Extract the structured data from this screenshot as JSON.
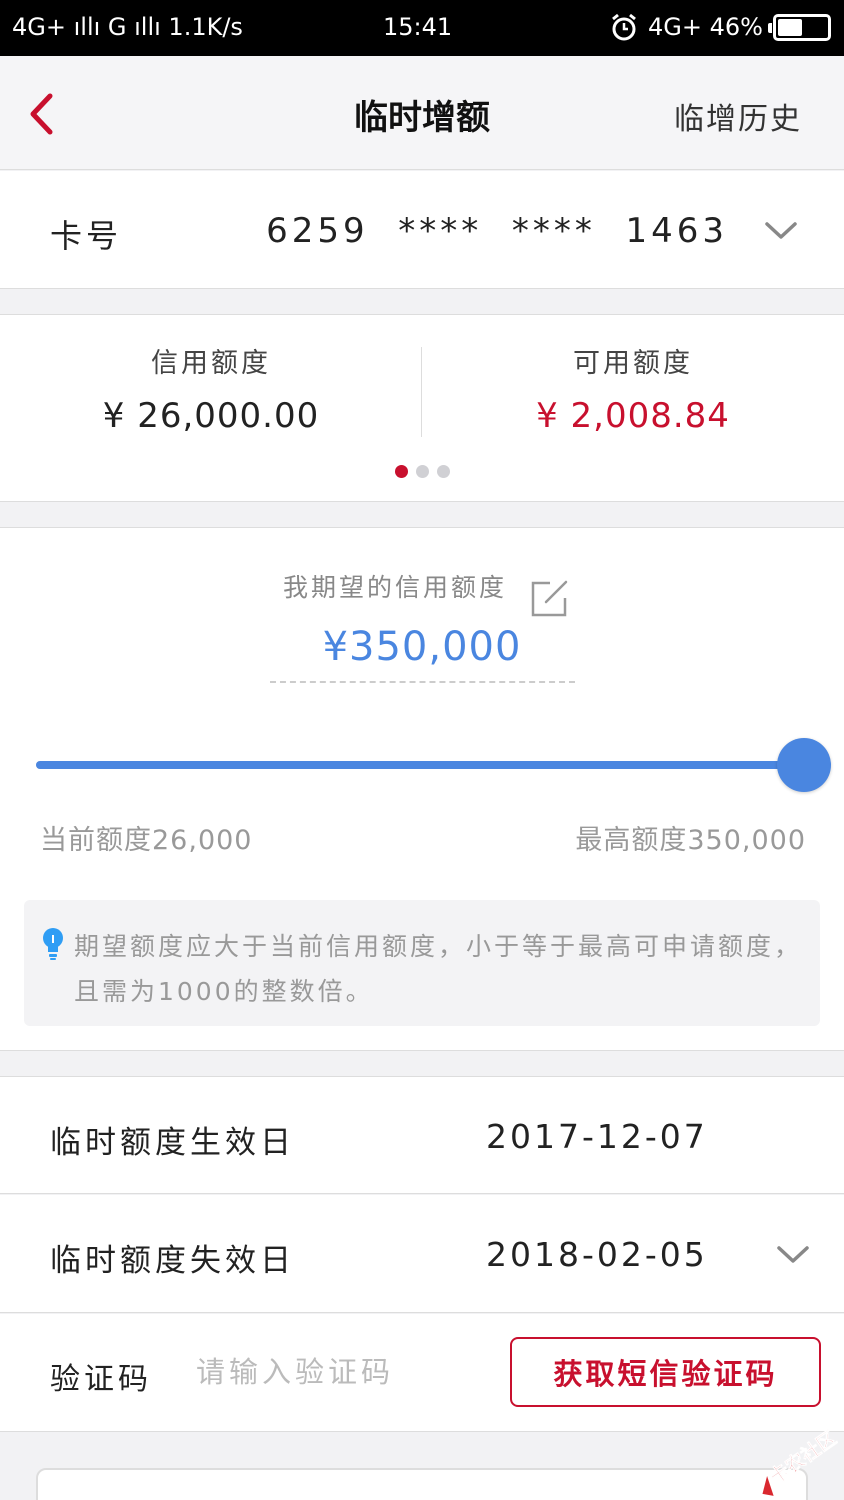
{
  "status_bar": {
    "network_left": "4G+ ıllı G ıllı 1.1K/s",
    "time": "15:41",
    "alarm_icon": "alarm-clock-icon",
    "network_right": "4G+ 46%",
    "battery_level": 0.46
  },
  "nav": {
    "back_icon": "chevron-left-icon",
    "title": "临时增额",
    "history_link": "临增历史"
  },
  "card": {
    "label": "卡号",
    "number": "6259  ****  ****  1463",
    "dropdown_icon": "chevron-down-icon"
  },
  "limits": {
    "credit_label": "信用额度",
    "credit_value": "¥ 26,000.00",
    "available_label": "可用额度",
    "available_value": "¥ 2,008.84",
    "page_count": 3,
    "active_page": 1
  },
  "expectation": {
    "label": "我期望的信用额度",
    "edit_icon": "edit-icon",
    "value": "¥350,000",
    "slider_fraction": 1.0,
    "min_label": "当前额度26,000",
    "max_label": "最高额度350,000",
    "tip_icon": "lightbulb-icon",
    "tip_text": "期望额度应大于当前信用额度，小于等于最高可申请额度，且需为1000的整数倍。"
  },
  "dates": {
    "start_label": "临时额度生效日",
    "start_value": "2017-12-07",
    "end_label": "临时额度失效日",
    "end_value": "2018-02-05"
  },
  "verification": {
    "label": "验证码",
    "input_value": "",
    "placeholder": "请输入验证码",
    "sms_button": "获取短信验证码"
  },
  "watermark": {
    "text": "卡农社区"
  },
  "colors": {
    "brand_red": "#c8102e",
    "accent_blue": "#4a86e0"
  }
}
